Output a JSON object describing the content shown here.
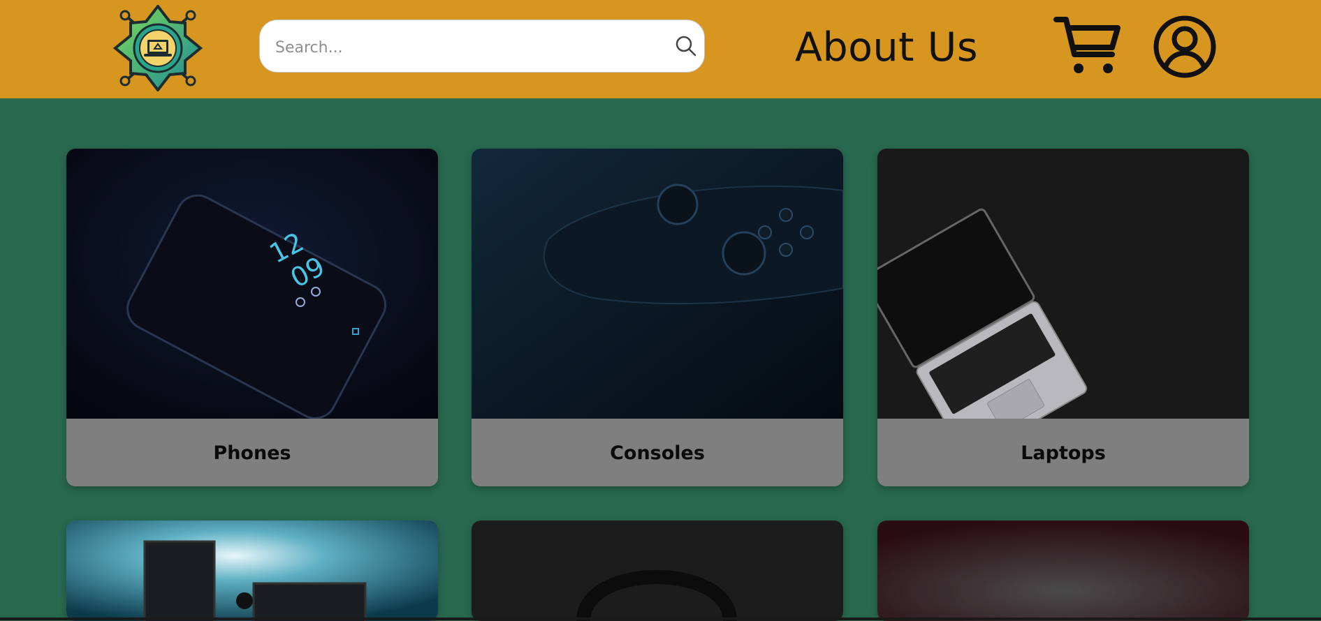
{
  "header": {
    "logo_alt": "recycled electronics logo",
    "search": {
      "placeholder": "Search...",
      "value": ""
    },
    "about_label": "About Us",
    "icons": {
      "search": "search-icon",
      "cart": "cart-icon",
      "user": "user-account-icon"
    }
  },
  "categories": [
    {
      "label": "Phones",
      "image": "dark smartphone showing clock 12:09"
    },
    {
      "label": "Consoles",
      "image": "dark game controller"
    },
    {
      "label": "Laptops",
      "image": "silver laptop on dark surface"
    },
    {
      "label": "",
      "image": "computer monitors with blue backlight"
    },
    {
      "label": "",
      "image": "headphones on dark background"
    },
    {
      "label": "",
      "image": "dark red blurred background"
    }
  ],
  "colors": {
    "header_bg": "#d6961f",
    "page_bg": "#28684f",
    "card_label_bg": "#7f7f7f"
  }
}
